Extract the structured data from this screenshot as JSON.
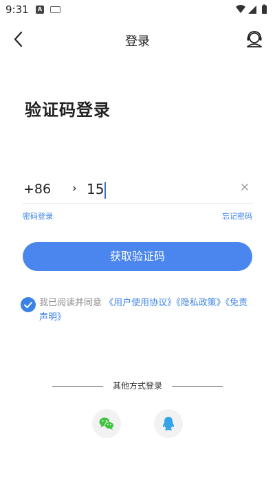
{
  "status_bar": {
    "time": "9:31",
    "notification_icons": [
      "a-icon",
      "keyboard-icon"
    ],
    "system_icons": [
      "wifi-icon",
      "signal-icon",
      "battery-icon"
    ]
  },
  "nav": {
    "title": "登录",
    "back_icon": "chevron-left-icon",
    "service_icon": "customer-service-icon"
  },
  "page_title": "验证码登录",
  "phone": {
    "country_code": "+86",
    "chevron": "›",
    "value": "15",
    "clear_icon": "close-icon"
  },
  "links": {
    "password_login": "密码登录",
    "forgot_password": "忘记密码"
  },
  "submit": {
    "label": "获取验证码"
  },
  "agreement": {
    "checked": true,
    "prefix": "我已阅读并同意 ",
    "user_agreement": "《用户使用协议》",
    "privacy_policy": "《隐私政策》",
    "disclaimer": "《免责声明》"
  },
  "other_login": {
    "label": "其他方式登录",
    "methods": [
      {
        "name": "wechat",
        "icon": "wechat-icon",
        "color": "#3ec33f"
      },
      {
        "name": "qq",
        "icon": "qq-icon",
        "color": "#35a4e9"
      }
    ]
  },
  "colors": {
    "accent": "#3b82e6",
    "button": "#4a86ee"
  }
}
